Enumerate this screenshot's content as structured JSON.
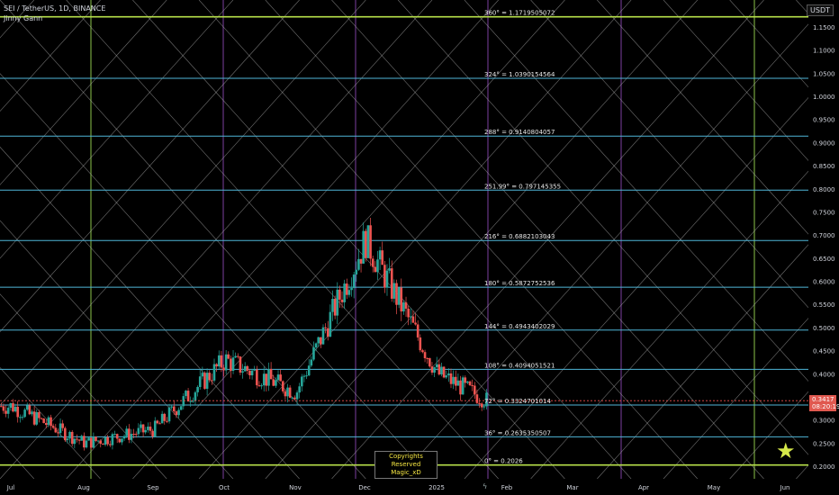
{
  "header": {
    "symbol_line": "SEI / TetherUS, 1D, BINANCE",
    "indicator_line": "Jinny Gann"
  },
  "price_axis": {
    "currency_button": "USDT",
    "ticks": [
      "1.1500",
      "1.1000",
      "1.0500",
      "1.0000",
      "0.9500",
      "0.9000",
      "0.8500",
      "0.8000",
      "0.7500",
      "0.7000",
      "0.6500",
      "0.6000",
      "0.5500",
      "0.5000",
      "0.4500",
      "0.4000",
      "0.3500",
      "0.3000",
      "0.2500",
      "0.2000"
    ],
    "current_price_badge": {
      "price": "0.3417",
      "countdown": "08:20:19",
      "color": "#e0584f"
    }
  },
  "time_axis": {
    "labels": [
      "Jul",
      "Aug",
      "Sep",
      "Oct",
      "Nov",
      "Dec",
      "2025",
      "Feb",
      "Mar",
      "Apr",
      "May",
      "Jun"
    ]
  },
  "gann_levels": [
    {
      "label": "360° = 1.1719505072",
      "price": 1.1719505072,
      "color": "#b7e04a"
    },
    {
      "label": "324° = 1.0390154564",
      "price": 1.0390154564,
      "color": "#4fb6d8"
    },
    {
      "label": "288° = 0.9140804057",
      "price": 0.9140804057,
      "color": "#4fb6d8"
    },
    {
      "label": "251.99° = 0.797145355",
      "price": 0.797145355,
      "color": "#4fb6d8"
    },
    {
      "label": "216° = 0.6882103043",
      "price": 0.6882103043,
      "color": "#4fb6d8"
    },
    {
      "label": "180° = 0.5872752536",
      "price": 0.5872752536,
      "color": "#4fb6d8"
    },
    {
      "label": "144° = 0.4943402029",
      "price": 0.4943402029,
      "color": "#4fb6d8"
    },
    {
      "label": "108° = 0.4094051521",
      "price": 0.4094051521,
      "color": "#4fb6d8"
    },
    {
      "label": "72° = 0.3324701014",
      "price": 0.3324701014,
      "color": "#4fb6d8"
    },
    {
      "label": "36° = 0.2635350507",
      "price": 0.2635350507,
      "color": "#4fb6d8"
    },
    {
      "label": "0° = 0.2026",
      "price": 0.2026,
      "color": "#b7e04a"
    }
  ],
  "watermark": {
    "line1": "Copyrights Reserved",
    "line2": "Magic_xD"
  },
  "colors": {
    "up": "#26a69a",
    "down": "#ef5350",
    "green_vertical": "#8bc34a",
    "purple_vertical": "#7b3fa0",
    "diagonal": "#c8c8c8"
  },
  "icons": {
    "star": "star-icon",
    "time_marker": "lightning-icon"
  },
  "chart_data": {
    "type": "candlestick",
    "interval": "1D",
    "ylim": [
      0.18,
      1.18
    ],
    "key_prices": [
      {
        "month": "Jul",
        "close": 0.33
      },
      {
        "month": "Aug",
        "close": 0.25
      },
      {
        "month": "Sep",
        "close": 0.28
      },
      {
        "month": "Oct",
        "close": 0.43
      },
      {
        "month": "Nov",
        "close": 0.36
      },
      {
        "month": "Dec",
        "close": 0.69
      },
      {
        "month": "2025",
        "close": 0.4
      },
      {
        "month": "Feb",
        "close": 0.3417
      }
    ]
  }
}
